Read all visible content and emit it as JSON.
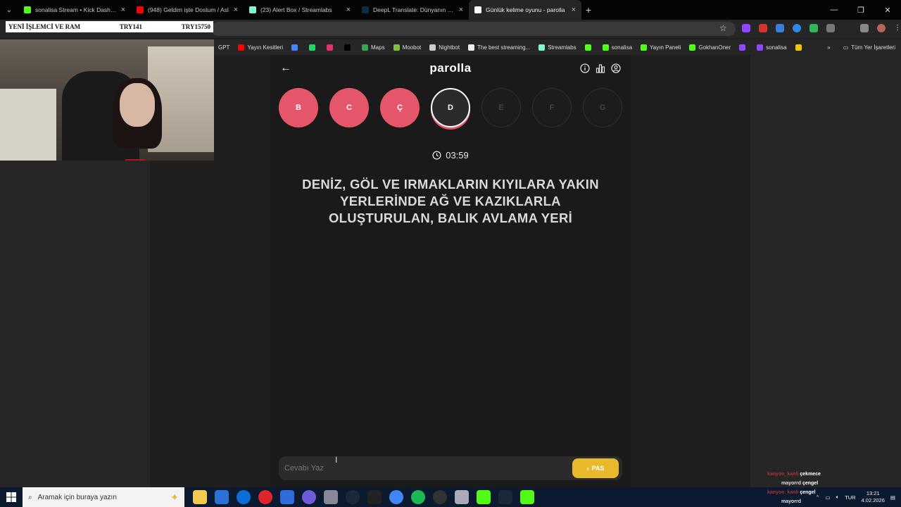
{
  "browser": {
    "tabs": [
      {
        "title": "sonalisa Stream • Kick Dashboa",
        "color": "#53fc18"
      },
      {
        "title": "(948) Geldim işte Dostum / Asl",
        "color": "#ff0000"
      },
      {
        "title": "(23) Alert Box / Streamlabs",
        "color": "#80f5d2"
      },
      {
        "title": "DeepL Translate: Dünyanın en d",
        "color": "#0f2b46"
      },
      {
        "title": "Günlük kelime oyunu - parolla",
        "color": "#ffffff"
      }
    ],
    "bookmarks": [
      {
        "label": "GPT",
        "color": "#777777"
      },
      {
        "label": "Yayın Kesitleri",
        "color": "#ff0000"
      },
      {
        "label": "",
        "color": "#4285f4"
      },
      {
        "label": "",
        "color": "#25d366"
      },
      {
        "label": "",
        "color": "#e1306c"
      },
      {
        "label": "",
        "color": "#000000"
      },
      {
        "label": "Maps",
        "color": "#34a853"
      },
      {
        "label": "Moobot",
        "color": "#7fc241"
      },
      {
        "label": "Nightbot",
        "color": "#cccccc"
      },
      {
        "label": "The best streaming...",
        "color": "#eeeeee"
      },
      {
        "label": "Streamlabs",
        "color": "#80f5d2"
      },
      {
        "label": "",
        "color": "#53fc18"
      },
      {
        "label": "sonalisa",
        "color": "#53fc18"
      },
      {
        "label": "Yayın Paneli",
        "color": "#53fc18"
      },
      {
        "label": "GokhanOner",
        "color": "#53fc18"
      },
      {
        "label": "",
        "color": "#9146ff"
      },
      {
        "label": "sonalisa",
        "color": "#9146ff"
      },
      {
        "label": "",
        "color": "#f4c20d"
      }
    ],
    "bookmarks_all": "Tüm Yer İşaretleri"
  },
  "overlay": {
    "product": "YENİ İŞLEMCİ VE RAM",
    "current": "TRY141",
    "goal": "TRY15750"
  },
  "game": {
    "logo": "parolla",
    "letters": [
      {
        "letter": "B",
        "state": "done"
      },
      {
        "letter": "C",
        "state": "done"
      },
      {
        "letter": "Ç",
        "state": "done"
      },
      {
        "letter": "D",
        "state": "current"
      },
      {
        "letter": "E",
        "state": "pending"
      },
      {
        "letter": "F",
        "state": "pending"
      },
      {
        "letter": "G",
        "state": "pending"
      }
    ],
    "timer": "03:59",
    "question": "DENİZ, GÖL VE IRMAKLARIN KIYILARA YAKIN YERLERİNDE AĞ VE KAZIKLARLA OLUŞTURULAN, BALIK AVLAMA YERİ",
    "answer_placeholder": "Cevabı Yaz",
    "pass_label": "PAS",
    "accent": "#e5566a",
    "pass_color": "#e7b92b"
  },
  "chat": [
    {
      "user": "kanyon_kanli",
      "msg": "çekmece"
    },
    {
      "user": "mayorrd",
      "msg": "çengel"
    },
    {
      "user": "kanyon_kanli",
      "msg": "çengel"
    },
    {
      "user": "mayorrd",
      "msg": ""
    }
  ],
  "taskbar": {
    "search_placeholder": "Aramak için buraya yazın",
    "language": "TUR",
    "time": "13:21",
    "date": "4.02.2026"
  }
}
